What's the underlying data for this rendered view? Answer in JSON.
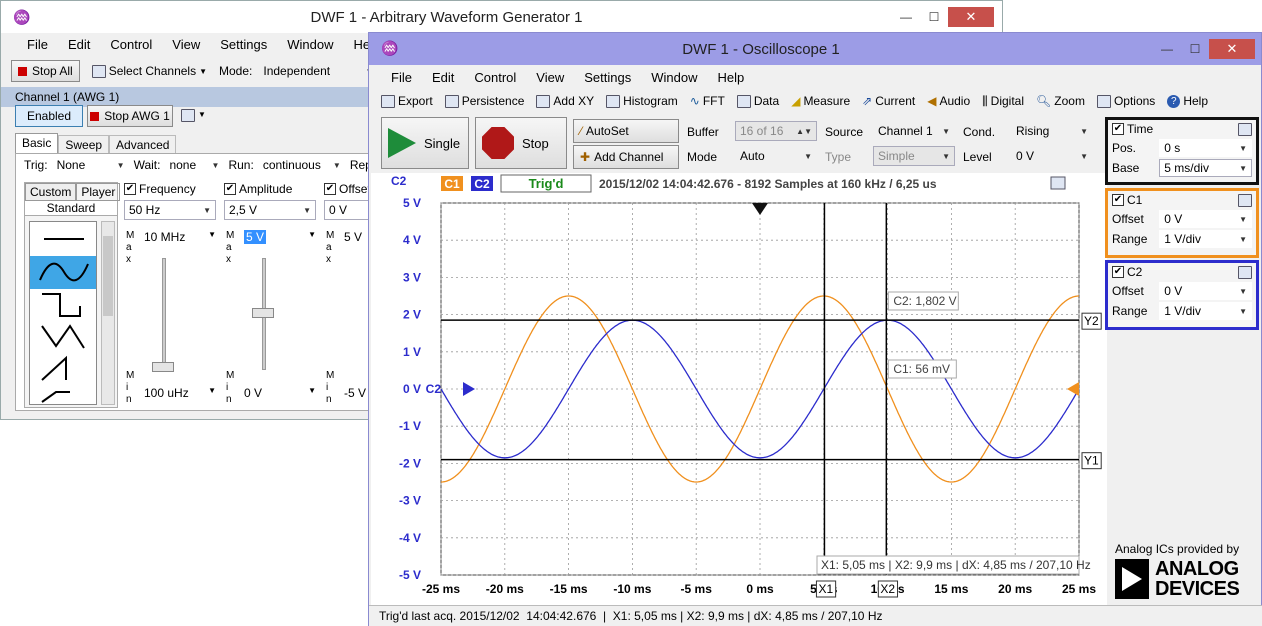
{
  "awg": {
    "title": "DWF 1 - Arbitrary Waveform Generator 1",
    "menu": [
      "File",
      "Edit",
      "Control",
      "View",
      "Settings",
      "Window",
      "Help"
    ],
    "toolbar": {
      "stop_all": "Stop All",
      "select_channels": "Select Channels",
      "mode_label": "Mode:",
      "mode_value": "Independent"
    },
    "channel_header": "Channel 1 (AWG 1)",
    "enabled": "Enabled",
    "stop_awg": "Stop AWG 1",
    "tabs": [
      "Basic",
      "Sweep",
      "Advanced"
    ],
    "trig_label": "Trig:",
    "trig_value": "None",
    "wait_label": "Wait:",
    "wait_value": "none",
    "run_label": "Run:",
    "run_value": "continuous",
    "repeat_label": "Repe",
    "shape_tabs": [
      "Custom",
      "Player"
    ],
    "standard": "Standard",
    "frequency": {
      "label": "Frequency",
      "value": "50 Hz",
      "max": "10 MHz",
      "min": "100 uHz"
    },
    "amplitude": {
      "label": "Amplitude",
      "value": "2,5 V",
      "max": "5 V",
      "min": "0 V"
    },
    "offset": {
      "label": "Offset",
      "value": "0 V",
      "max": "5 V",
      "min": "-5 V"
    },
    "max_letters": "M\na\nx",
    "min_letters": "M\ni\nn"
  },
  "scope": {
    "title": "DWF 1 - Oscilloscope 1",
    "menu": [
      "File",
      "Edit",
      "Control",
      "View",
      "Settings",
      "Window",
      "Help"
    ],
    "toolbar": [
      "Export",
      "Persistence",
      "Add XY",
      "Histogram",
      "FFT",
      "Data",
      "Measure",
      "Current",
      "Audio",
      "Digital",
      "Zoom",
      "Options",
      "Help"
    ],
    "single": "Single",
    "stop": "Stop",
    "autoset": "AutoSet",
    "add_channel": "Add Channel",
    "buffer_label": "Buffer",
    "buffer_value": "16 of 16",
    "mode_label": "Mode",
    "mode_value": "Auto",
    "source_label": "Source",
    "source_value": "Channel 1",
    "type_label": "Type",
    "type_value": "Simple",
    "cond_label": "Cond.",
    "cond_value": "Rising",
    "level_label": "Level",
    "level_value": "0 V",
    "status_bar": "Trig'd last acq. 2015/12/02  14:04:42.676  |  X1: 5,05 ms | X2: 9,9 ms | dX: 4,85 ms / 207,10 Hz",
    "time": {
      "label": "Time",
      "pos_label": "Pos.",
      "pos_value": "0 s",
      "base_label": "Base",
      "base_value": "5 ms/div"
    },
    "c1": {
      "label": "C1",
      "offset_label": "Offset",
      "offset_value": "0 V",
      "range_label": "Range",
      "range_value": "1 V/div"
    },
    "c2": {
      "label": "C2",
      "offset_label": "Offset",
      "offset_value": "0 V",
      "range_label": "Range",
      "range_value": "1 V/div"
    },
    "brand_caption": "Analog ICs provided by",
    "brand_line1": "ANALOG",
    "brand_line2": "DEVICES"
  },
  "colors": {
    "c1": "#f0901e",
    "c2": "#2c2ccc",
    "title_purple": "#9c9ce6"
  },
  "chart_data": {
    "type": "line",
    "y_axis_label": "C2",
    "c1_tag": "C1",
    "c2_tag": "C2",
    "status_tag": "Trig'd",
    "info": "2015/12/02  14:04:42.676 - 8192 Samples at 160 kHz / 6,25 us",
    "xlim": [
      -25,
      25
    ],
    "ylim": [
      -5,
      5
    ],
    "x_ticks": [
      "-25 ms",
      "-20 ms",
      "-15 ms",
      "-10 ms",
      "-5 ms",
      "0 ms",
      "5 ms",
      "10 ms",
      "15 ms",
      "20 ms",
      "25 ms"
    ],
    "y_ticks": [
      "5 V",
      "4 V",
      "3 V",
      "2 V",
      "1 V",
      "0 V",
      "-1 V",
      "-2 V",
      "-3 V",
      "-4 V",
      "-5 V"
    ],
    "series": [
      {
        "name": "C1",
        "amplitude": 2.5,
        "frequency_hz": 50,
        "phase": "sin",
        "color": "#f0901e"
      },
      {
        "name": "C2",
        "amplitude": 1.85,
        "frequency_hz": 50,
        "phase": "-cos",
        "color": "#2c2ccc"
      }
    ],
    "cursors": {
      "X1": 5.05,
      "X2": 9.9,
      "Y1": -1.9,
      "Y2": 1.85,
      "X1_label": "X1",
      "X2_label": "X2",
      "Y1_label": "Y1",
      "Y2_label": "Y2"
    },
    "readouts": {
      "c2": "C2: 1,802 V",
      "c1": "C1: 56 mV",
      "dx": "X1: 5,05 ms | X2: 9,9 ms | dX: 4,85 ms / 207,10 Hz"
    },
    "c2_marker": "C2"
  }
}
